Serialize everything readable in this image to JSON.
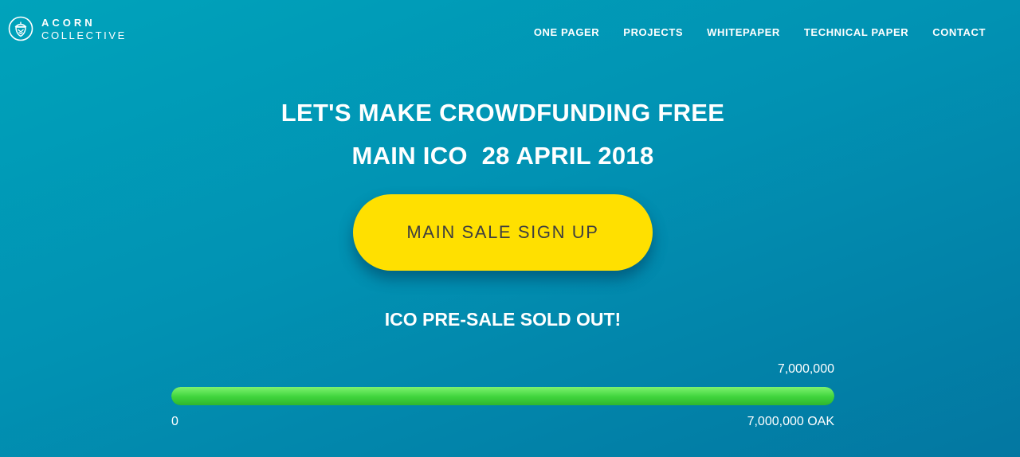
{
  "header": {
    "logo_line1": "ACORN",
    "logo_line2": "COLLECTIVE",
    "nav": [
      {
        "label": "ONE PAGER"
      },
      {
        "label": "PROJECTS"
      },
      {
        "label": "WHITEPAPER"
      },
      {
        "label": "TECHNICAL PAPER"
      },
      {
        "label": "CONTACT"
      }
    ]
  },
  "hero": {
    "title": "LET'S MAKE CROWDFUNDING FREE",
    "subtitle": "MAIN ICO  28 APRIL 2018",
    "cta_label": "MAIN SALE SIGN UP",
    "status": "ICO PRE-SALE SOLD OUT!"
  },
  "progress": {
    "top_label": "7,000,000",
    "min_label": "0",
    "max_label": "7,000,000 OAK",
    "value_fraction": 1.0
  },
  "colors": {
    "background_start": "#00a3bb",
    "background_end": "#0377a1",
    "cta_background": "#ffe000",
    "cta_text": "#3f3f3f",
    "progress_fill": "#3fd43c"
  },
  "icons": {
    "logo": "acorn-logo-icon"
  }
}
